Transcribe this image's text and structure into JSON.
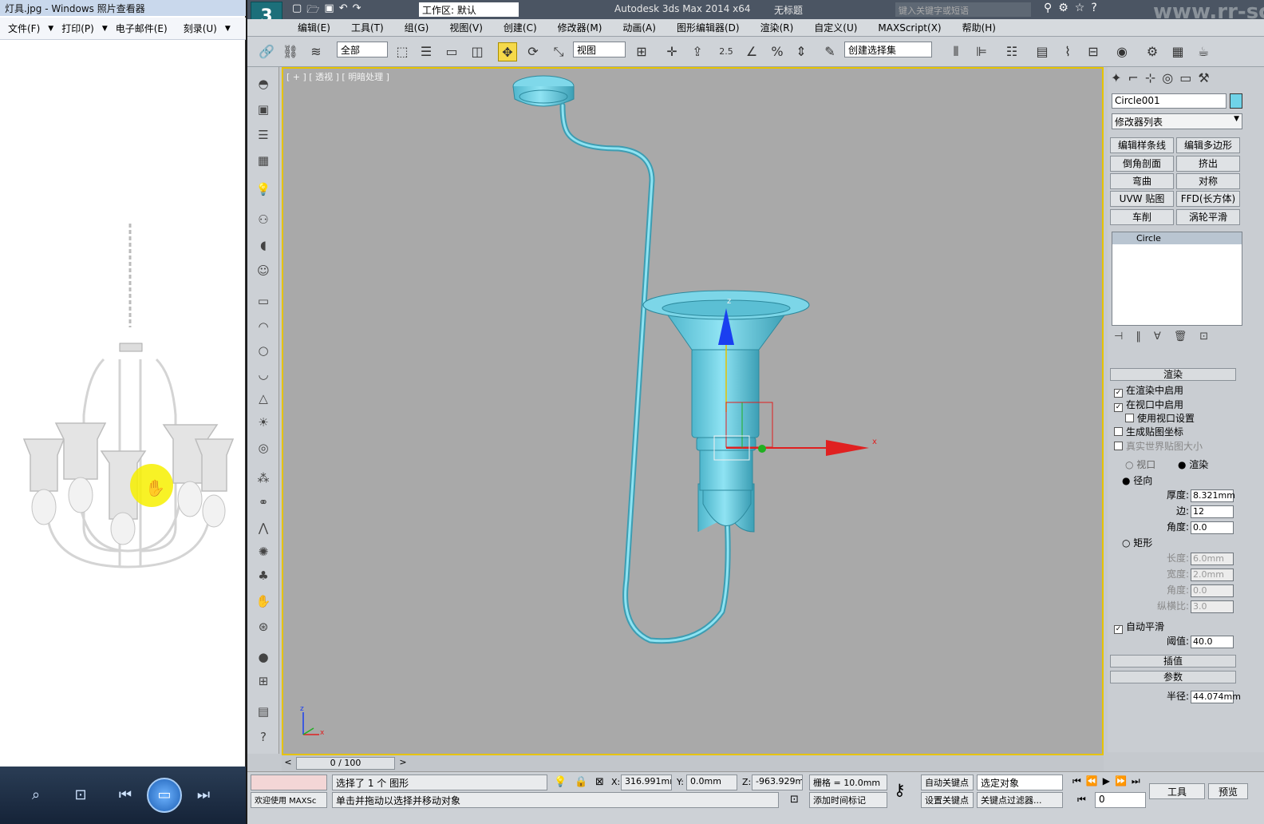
{
  "photo_viewer": {
    "title": "灯具.jpg - Windows 照片查看器",
    "menu": [
      "文件(F)",
      "打印(P)",
      "电子邮件(E)",
      "刻录(U)"
    ]
  },
  "max": {
    "title": "Autodesk 3ds Max  2014 x64",
    "doc_title": "无标题",
    "workspace": "工作区: 默认",
    "search_placeholder": "键入关键字或短语",
    "menu": [
      "编辑(E)",
      "工具(T)",
      "组(G)",
      "视图(V)",
      "创建(C)",
      "修改器(M)",
      "动画(A)",
      "图形编辑器(D)",
      "渲染(R)",
      "自定义(U)",
      "MAXScript(X)",
      "帮助(H)"
    ],
    "toolbar": {
      "filter": "全部",
      "ref_coord": "视图",
      "snap_value": "2.5",
      "selection_set": "创建选择集"
    },
    "viewport": {
      "label": "[ + ] [ 透视 ] [ 明暗处理 ]",
      "axis_x": "x",
      "axis_z": "z"
    },
    "watermark": "www.rr-sc.com"
  },
  "panel": {
    "object_name": "Circle001",
    "modifier_list": "修改器列表",
    "modifiers": [
      "编辑样条线",
      "编辑多边形",
      "倒角剖面",
      "挤出",
      "弯曲",
      "对称",
      "UVW 贴图",
      "FFD(长方体)",
      "车削",
      "涡轮平滑"
    ],
    "stack_item": "Circle",
    "rollout_render": "渲染",
    "render": {
      "enable_render": "在渲染中启用",
      "enable_viewport": "在视口中启用",
      "use_viewport": "使用视口设置",
      "gen_mapping": "生成贴图坐标",
      "real_world": "真实世界贴图大小",
      "viewport_opt": "视口",
      "render_opt": "渲染",
      "radial": "径向",
      "thickness_label": "厚度:",
      "thickness": "8.321mm",
      "sides_label": "边:",
      "sides": "12",
      "angle_label": "角度:",
      "angle": "0.0",
      "rect": "矩形",
      "length_label": "长度:",
      "length": "6.0mm",
      "width_label": "宽度:",
      "width": "2.0mm",
      "rect_angle": "0.0",
      "aspect_label": "纵横比:",
      "aspect": "3.0",
      "auto_smooth": "自动平滑",
      "threshold_label": "阈值:",
      "threshold": "40.0"
    },
    "rollout_interp": "插值",
    "rollout_params": "参数",
    "radius_label": "半径:",
    "radius": "44.074mm"
  },
  "timeline": {
    "frame": "0 / 100"
  },
  "status": {
    "selected": "选择了 1 个 图形",
    "welcome": "欢迎使用 MAXSc",
    "prompt": "单击并拖动以选择并移动对象",
    "x_label": "X:",
    "x": "316.991mm",
    "y_label": "Y:",
    "y": "0.0mm",
    "z_label": "Z:",
    "z": "-963.929m",
    "grid": "栅格 = 10.0mm",
    "add_time_tag": "添加时间标记",
    "auto_key": "自动关键点",
    "set_key": "设置关键点",
    "selected_obj": "选定对象",
    "key_filters": "关键点过滤器...",
    "frame_value": "0",
    "tools": "工具",
    "preview": "预览"
  },
  "colors": {
    "object": "#6fd3e8",
    "viewport_bg": "#a9a9a9",
    "viewport_border": "#e6c300",
    "gizmo_x": "#e02020",
    "gizmo_y": "#20b020",
    "gizmo_z": "#1a3ff0"
  }
}
